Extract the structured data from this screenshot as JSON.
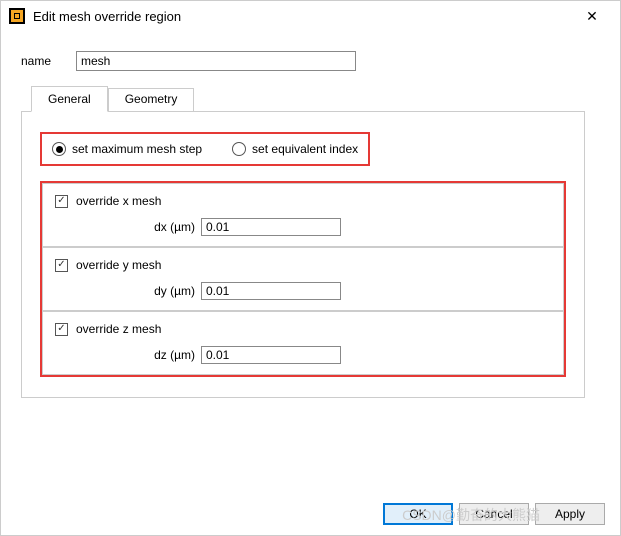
{
  "window": {
    "title": "Edit mesh override region"
  },
  "name": {
    "label": "name",
    "value": "mesh"
  },
  "tabs": {
    "general": "General",
    "geometry": "Geometry"
  },
  "radios": {
    "max_step": "set maximum mesh step",
    "equiv_index": "set equivalent index"
  },
  "overrides": {
    "x": {
      "check_label": "override x mesh",
      "dim_label": "dx (µm)",
      "value": "0.01"
    },
    "y": {
      "check_label": "override y mesh",
      "dim_label": "dy (µm)",
      "value": "0.01"
    },
    "z": {
      "check_label": "override z mesh",
      "dim_label": "dz (µm)",
      "value": "0.01"
    }
  },
  "buttons": {
    "ok": "OK",
    "cancel": "Cancel",
    "apply": "Apply"
  },
  "watermark": "CSDN@勤奋的大熊猫"
}
